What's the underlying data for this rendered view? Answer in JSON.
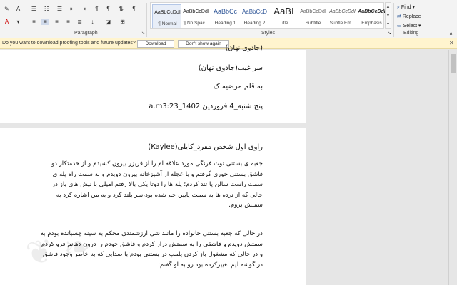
{
  "ribbon": {
    "paragraph_label": "Paragraph",
    "styles_label": "Styles",
    "editing_label": "Editing",
    "styles": [
      {
        "sample": "AaBbCcDdI",
        "name": "¶ Normal"
      },
      {
        "sample": "AaBbCcDdI",
        "name": "¶ No Spac..."
      },
      {
        "sample": "AaBbCc",
        "name": "Heading 1"
      },
      {
        "sample": "AaBbCcD",
        "name": "Heading 2"
      },
      {
        "sample": "AaBI",
        "name": "Title"
      },
      {
        "sample": "AaBbCcDdI",
        "name": "Subtitle"
      },
      {
        "sample": "AaBbCcDdI",
        "name": "Subtle Em..."
      },
      {
        "sample": "AaBbCcDdI",
        "name": "Emphasis"
      }
    ],
    "find_label": "Find",
    "replace_label": "Replace",
    "select_label": "Select"
  },
  "infobar": {
    "message": "Do you want to download proofing tools and future updates?",
    "download_label": "Download",
    "dismiss_label": "Don't show again"
  },
  "document": {
    "page1_line0": "(جادوی نهان)",
    "page1_line1": "سر غیب(جادوی نهان)",
    "page1_line2": "به قلم مرضیه.ک",
    "page1_line3": "پنج شنبه_4 فروردین 1402_a.m3:23",
    "narrator": "راوی اول شخص مفرد_کایلی(Kaylee)",
    "para1": "جعبه ی بستنی توت فرنگی مورد علاقه ام را از فریزر بیرون کشیدم و از خدمتکار دو قاشق بستنی خوری گرفتم و با عجله از آشپزخانه بیرون دویدم و به سمت راه پله ی سمت راست سالن پا تند کردم؛ پله ها را دوتا یکی بالا رفتم.امیلی با نیش های باز در حالی که از نرده ها به سمت پایین خم شده بود،سر بلند کرد و به من اشاره کرد به سمتش بروم.",
    "para2": "در حالی که جعبه بستنی خانواده را مانند شی ارزشمندی محکم به سینه چسبانده بودم به سمتش دویدم و قاشقی را به سمتش دراز کردم و قاشق خودم را درون دهانم فرو کردم و در حالی که مشغول باز کردن پلمپ در بستنی بودم؛با صدایی که به خاطر وجود قاشق در گوشه لپم تغییرکرده بود رو به او گفتم:"
  }
}
